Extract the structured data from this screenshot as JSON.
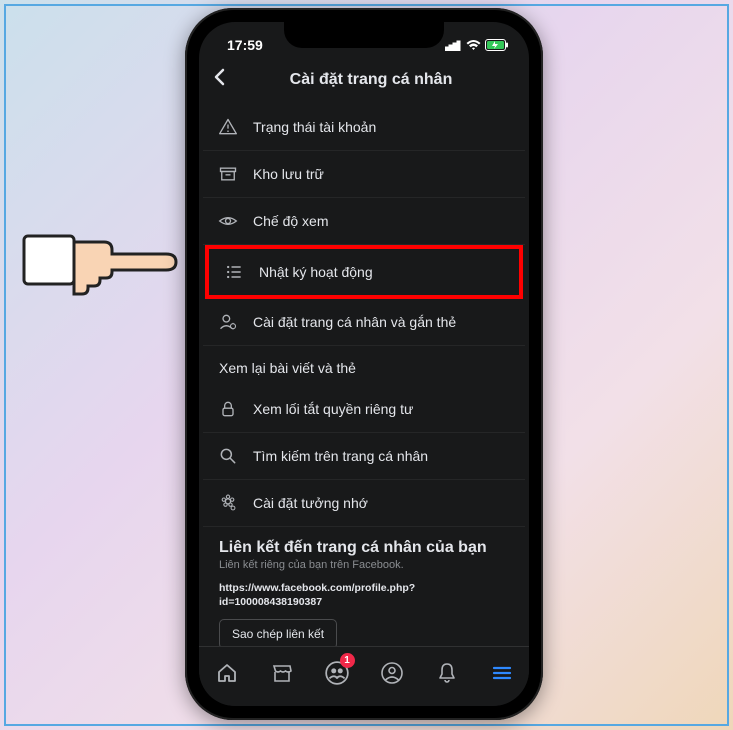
{
  "status": {
    "time": "17:59"
  },
  "header": {
    "title": "Cài đặt trang cá nhân"
  },
  "rows": [
    {
      "label": "Trạng thái tài khoản"
    },
    {
      "label": "Kho lưu trữ"
    },
    {
      "label": "Chế độ xem"
    },
    {
      "label": "Nhật ký hoạt động"
    },
    {
      "label": "Cài đặt trang cá nhân và gắn thẻ"
    }
  ],
  "section_header": "Xem lại bài viết và thẻ",
  "rows2": [
    {
      "label": "Xem lối tắt quyền riêng tư"
    },
    {
      "label": "Tìm kiếm trên trang cá nhân"
    },
    {
      "label": "Cài đặt tưởng nhớ"
    }
  ],
  "link_section": {
    "title": "Liên kết đến trang cá nhân của bạn",
    "subtitle": "Liên kết riêng của bạn trên Facebook.",
    "url_line1": "https://www.facebook.com/profile.php?",
    "url_line2": "id=100008438190387",
    "copy_label": "Sao chép liên kết"
  },
  "badge_count": "1"
}
